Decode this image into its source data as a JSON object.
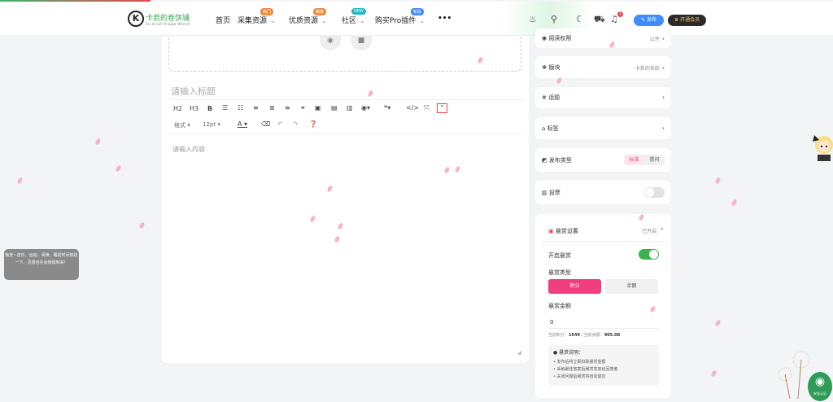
{
  "header": {
    "logo": {
      "name": "卡若的卷饼铺",
      "tagline": "For all eat of Sugar Wrench",
      "icon": "k-logo-icon"
    },
    "nav": [
      {
        "label": "首页"
      },
      {
        "label": "采集资源",
        "badge": "热门",
        "badge_color": "#f0883e"
      },
      {
        "label": "优质资源",
        "badge": "推荐",
        "badge_color": "#f0883e"
      },
      {
        "label": "社区",
        "badge": "NEW",
        "badge_color": "#1fb6c5"
      },
      {
        "label": "购买Pro插件",
        "badge": "新版",
        "badge_color": "#3d8bfd"
      }
    ],
    "more_icon": "more-dots-icon",
    "notification_count": "1",
    "publish_label": "发布",
    "vip_label": "开通会员"
  },
  "editor": {
    "title_placeholder": "请输入标题",
    "toolbar_row1": [
      "H2",
      "H3",
      "B"
    ],
    "format_label": "格式",
    "font_size": "12pt",
    "font_color_label": "A",
    "content_placeholder": "请输入内容"
  },
  "sidebar": {
    "read_permission": {
      "label": "阅读权限",
      "value": "公开"
    },
    "section": {
      "label": "版块",
      "value": "卡若的系统"
    },
    "topic": {
      "label": "话题"
    },
    "tag": {
      "label": "标签"
    },
    "post_type": {
      "label": "发布类型",
      "options": [
        "标准",
        "提问"
      ],
      "selected": "标准"
    },
    "vote": {
      "label": "投票",
      "enabled": false
    },
    "bounty": {
      "label": "悬赏设置",
      "status": "已开启",
      "enable_label": "开启悬赏",
      "enabled": true,
      "type_label": "悬赏类型",
      "types": [
        "积分",
        "余额"
      ],
      "selected_type": "积分",
      "amount_label": "悬赏金额",
      "amount_value": "0",
      "balance_line_points_label": "当前积分：",
      "balance_points": "1649",
      "balance_line_money_label": "| 当前余额：",
      "balance_money": "905.08",
      "note_title": "悬赏说明：",
      "notes": [
        "• 发布后将立即扣除悬赏金额",
        "• 采纳最佳答案后悬赏发放给回答者",
        "• 关闭问题后悬赏将自动退还"
      ]
    }
  },
  "tooltip": "晚安~音乐、运动、阅读。睡前时间放松一下，灵感也许会悄悄到来！",
  "badge": "安全认证",
  "colors": {
    "accent_pink": "#ef3f7f",
    "toggle_green": "#3cb34a",
    "publish_blue": "#3d8bfd"
  }
}
